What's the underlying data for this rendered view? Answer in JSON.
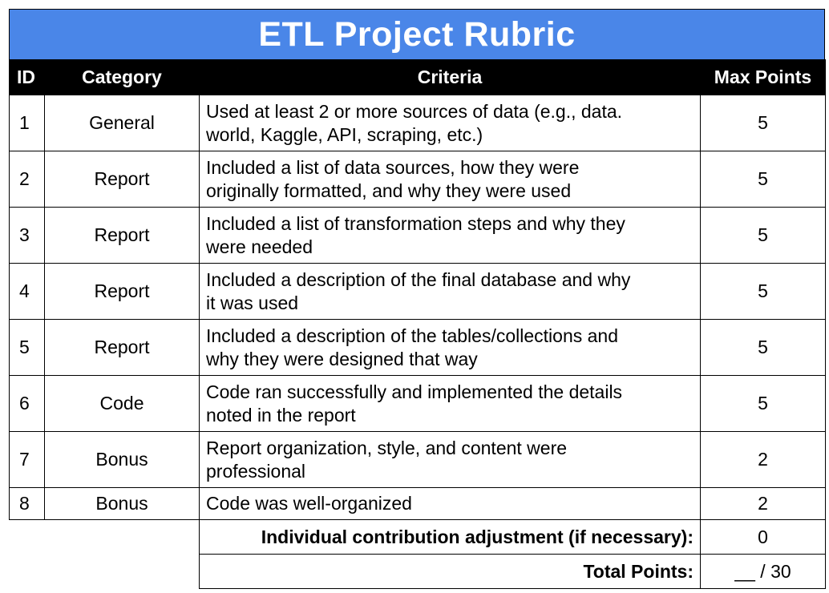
{
  "title": "ETL Project Rubric",
  "headers": {
    "id": "ID",
    "category": "Category",
    "criteria": "Criteria",
    "max_points": "Max Points"
  },
  "rows": [
    {
      "id": "1",
      "category": "General",
      "criteria_line1": "Used at least 2 or more sources of data (e.g., data.",
      "criteria_line2": "world, Kaggle, API, scraping, etc.)",
      "points": "5"
    },
    {
      "id": "2",
      "category": "Report",
      "criteria_line1": "Included a list of data sources, how they were",
      "criteria_line2": "originally formatted, and why they were used",
      "points": "5"
    },
    {
      "id": "3",
      "category": "Report",
      "criteria_line1": "Included a list of transformation steps and why they",
      "criteria_line2": "were needed",
      "points": "5"
    },
    {
      "id": "4",
      "category": "Report",
      "criteria_line1": "Included a description of the final database and why",
      "criteria_line2": "it was used",
      "points": "5"
    },
    {
      "id": "5",
      "category": "Report",
      "criteria_line1": "Included a description of the tables/collections and",
      "criteria_line2": "why they were designed that way",
      "points": "5"
    },
    {
      "id": "6",
      "category": "Code",
      "criteria_line1": "Code ran successfully and implemented the details",
      "criteria_line2": "noted in the report",
      "points": "5"
    },
    {
      "id": "7",
      "category": "Bonus",
      "criteria_line1": "Report organization, style, and content were",
      "criteria_line2": "professional",
      "points": "2"
    },
    {
      "id": "8",
      "category": "Bonus",
      "criteria_line1": "Code was well-organized",
      "criteria_line2": "",
      "points": "2"
    }
  ],
  "summary": {
    "adjustment_label": "Individual contribution adjustment (if necessary):",
    "adjustment_value": "0",
    "total_label": "Total Points:",
    "total_value": "__ / 30"
  }
}
